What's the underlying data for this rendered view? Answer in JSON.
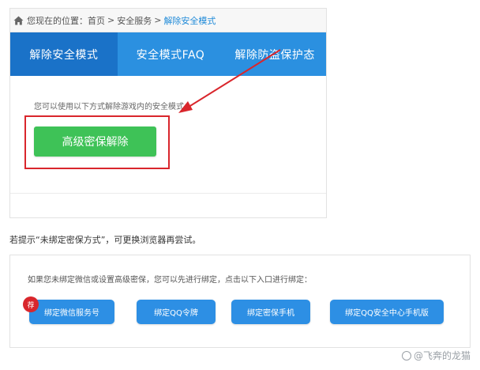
{
  "breadcrumb": {
    "icon": "home-icon",
    "prefix": "您现在的位置：",
    "home": "首页",
    "section": "安全服务",
    "current": "解除安全模式",
    "separator": ">"
  },
  "tabs": [
    {
      "label": "解除安全模式",
      "active": true
    },
    {
      "label": "安全模式FAQ",
      "active": false
    },
    {
      "label": "解除防盗保护态",
      "active": false
    }
  ],
  "unlock": {
    "hint": "您可以使用以下方式解除游戏内的安全模式：",
    "button": "高级密保解除"
  },
  "tip": "若提示“未绑定密保方式”，可更换浏览器再尝试。",
  "bind": {
    "hint": "如果您未绑定微信或设置高级密保，您可以先进行绑定，点击以下入口进行绑定：",
    "badge": "荐",
    "buttons": [
      {
        "label": "绑定微信服务号"
      },
      {
        "label": "绑定QQ令牌"
      },
      {
        "label": "绑定密保手机"
      },
      {
        "label": "绑定QQ安全中心手机版"
      }
    ]
  },
  "watermark": "@飞奔的龙猫",
  "colors": {
    "tab_bar": "#2b90e0",
    "tab_active": "#1a72c8",
    "unlock_button": "#3ec257",
    "bind_button": "#2d8fe4",
    "highlight": "#d9262c"
  }
}
